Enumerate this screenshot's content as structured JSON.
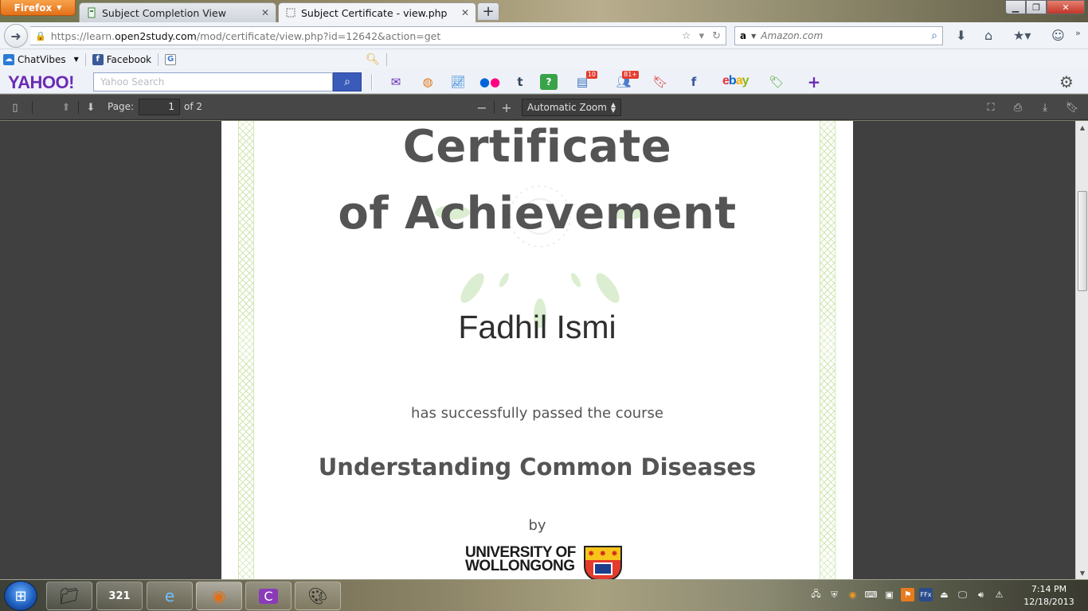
{
  "browser": {
    "app_button": "Firefox",
    "tabs": [
      {
        "label": "Subject Completion View"
      },
      {
        "label": "Subject Certificate - view.php"
      }
    ],
    "url_prefix": "https://learn.",
    "url_domain": "open2study.com",
    "url_path": "/mod/certificate/view.php?id=12642&action=get",
    "search_engine": "a",
    "search_placeholder": "Amazon.com"
  },
  "bookmarks": [
    {
      "label": "ChatVibes",
      "icon": "chatvibes-icon"
    },
    {
      "label": "Facebook",
      "icon": "facebook-icon"
    }
  ],
  "yahoo_toolbar": {
    "logo": "YAHOO!",
    "search_placeholder": "Yahoo Search",
    "news_badge": "10",
    "people_badge": "81+",
    "ebay": "ebay"
  },
  "pdf_toolbar": {
    "page_label": "Page:",
    "page_value": "1",
    "page_of": "of 2",
    "zoom": "Automatic Zoom"
  },
  "certificate": {
    "title_line1": "Certificate",
    "title_line2": "of Achievement",
    "recipient": "Fadhil Ismi",
    "passed_text": "has successfully passed the course",
    "course": "Understanding Common Diseases",
    "by": "by",
    "university_line1": "UNIVERSITY OF",
    "university_line2": "WOLLONGONG"
  },
  "taskbar": {
    "time": "7:14 PM",
    "date": "12/18/2013"
  },
  "colors": {
    "pdf_toolbar_bg": "#474747",
    "viewer_bg": "#404040",
    "title_text": "#545454",
    "border_green": "#cfe6b0",
    "yahoo_purple": "#6b2bb5",
    "yahoo_search_button": "#3a5bb9",
    "firefox_orange": "#e2701a"
  }
}
